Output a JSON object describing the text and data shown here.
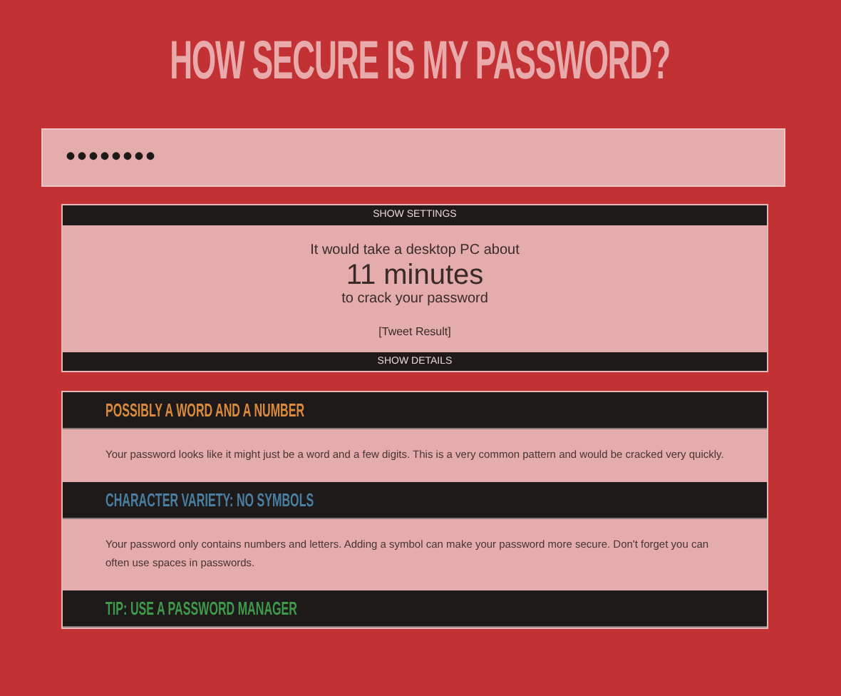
{
  "title": "HOW SECURE IS MY PASSWORD?",
  "password_field": {
    "value": "••••••••"
  },
  "result": {
    "settings_toggle": "SHOW SETTINGS",
    "lead": "It would take a desktop PC about",
    "time": "11 minutes",
    "tail": "to crack your password",
    "tweet_link": "[Tweet Result]",
    "details_toggle": "SHOW DETAILS"
  },
  "details": [
    {
      "heading": "POSSIBLY A WORD AND A NUMBER",
      "color": "#d98a3c",
      "text": "Your password looks like it might just be a word and a few digits. This is a very common pattern and would be cracked very quickly."
    },
    {
      "heading": "CHARACTER VARIETY: NO SYMBOLS",
      "color": "#4a7ea0",
      "text": "Your password only contains numbers and letters. Adding a symbol can make your password more secure. Don't forget you can often use spaces in passwords."
    },
    {
      "heading": "TIP: USE A PASSWORD MANAGER",
      "color": "#3e9a4a"
    }
  ]
}
